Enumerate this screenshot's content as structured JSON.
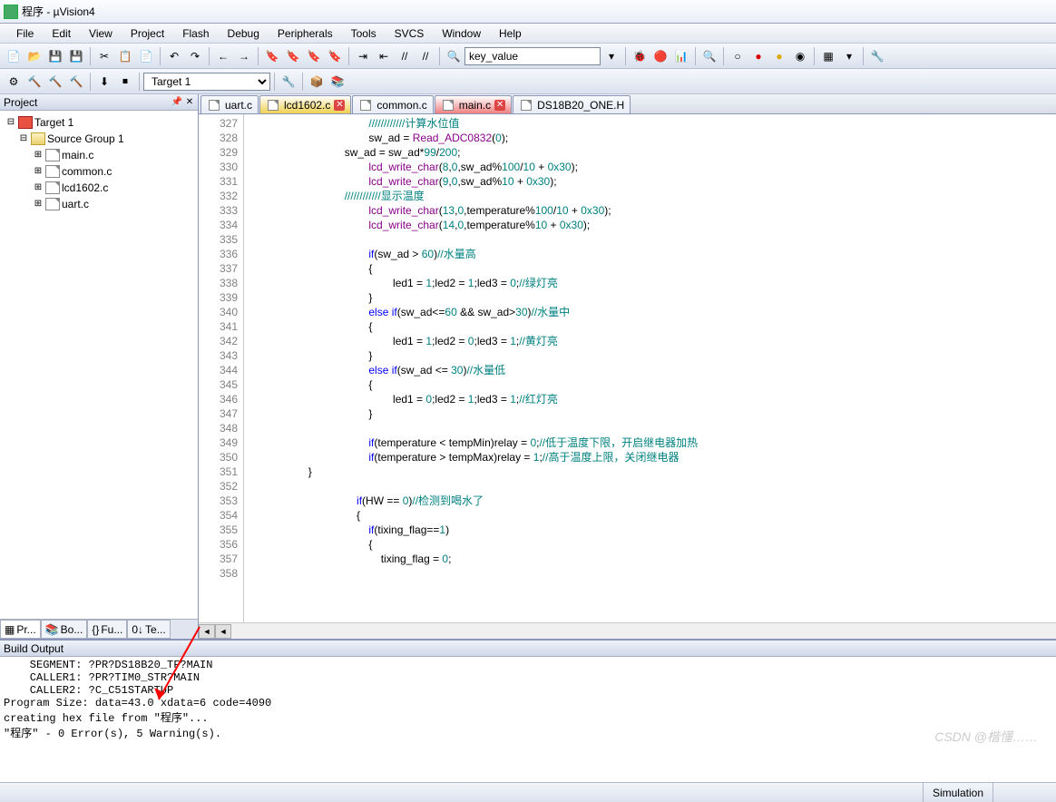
{
  "window_title": "程序 - µVision4",
  "menu": [
    "File",
    "Edit",
    "View",
    "Project",
    "Flash",
    "Debug",
    "Peripherals",
    "Tools",
    "SVCS",
    "Window",
    "Help"
  ],
  "toolbar2_combo": "key_value",
  "toolbar3_combo": "Target 1",
  "project_panel": {
    "title": "Project",
    "tree": {
      "root": "Target 1",
      "group": "Source Group 1",
      "files": [
        "main.c",
        "common.c",
        "lcd1602.c",
        "uart.c"
      ]
    },
    "tabs": [
      "Pr...",
      "Bo...",
      "Fu...",
      "Te..."
    ]
  },
  "file_tabs": [
    {
      "label": "uart.c",
      "active": false,
      "close": false
    },
    {
      "label": "lcd1602.c",
      "active": true,
      "close": true,
      "color": "#f0d050"
    },
    {
      "label": "common.c",
      "active": false,
      "close": false
    },
    {
      "label": "main.c",
      "active": false,
      "close": true,
      "color": "#f08080"
    },
    {
      "label": "DS18B20_ONE.H",
      "active": false,
      "close": false
    }
  ],
  "gutter_start": 327,
  "gutter_end": 358,
  "code_lines": [
    {
      "pad": 40,
      "seg": [
        {
          "t": "////////////计算水位值",
          "c": "com"
        }
      ]
    },
    {
      "pad": 40,
      "seg": [
        {
          "t": "sw_ad = "
        },
        {
          "t": "Read_ADC0832",
          "c": "fn"
        },
        {
          "t": "("
        },
        {
          "t": "0",
          "c": "num"
        },
        {
          "t": ");"
        }
      ]
    },
    {
      "pad": 32,
      "seg": [
        {
          "t": "sw_ad = sw_ad*"
        },
        {
          "t": "99",
          "c": "num"
        },
        {
          "t": "/"
        },
        {
          "t": "200",
          "c": "num"
        },
        {
          "t": ";"
        }
      ]
    },
    {
      "pad": 40,
      "seg": [
        {
          "t": "lcd_write_char",
          "c": "fn"
        },
        {
          "t": "("
        },
        {
          "t": "8",
          "c": "num"
        },
        {
          "t": ","
        },
        {
          "t": "0",
          "c": "num"
        },
        {
          "t": ",sw_ad%"
        },
        {
          "t": "100",
          "c": "num"
        },
        {
          "t": "/"
        },
        {
          "t": "10",
          "c": "num"
        },
        {
          "t": " + "
        },
        {
          "t": "0x30",
          "c": "num"
        },
        {
          "t": ");"
        }
      ]
    },
    {
      "pad": 40,
      "seg": [
        {
          "t": "lcd_write_char",
          "c": "fn"
        },
        {
          "t": "("
        },
        {
          "t": "9",
          "c": "num"
        },
        {
          "t": ","
        },
        {
          "t": "0",
          "c": "num"
        },
        {
          "t": ",sw_ad%"
        },
        {
          "t": "10",
          "c": "num"
        },
        {
          "t": " + "
        },
        {
          "t": "0x30",
          "c": "num"
        },
        {
          "t": ");"
        }
      ]
    },
    {
      "pad": 32,
      "seg": [
        {
          "t": "////////////显示温度",
          "c": "com"
        }
      ]
    },
    {
      "pad": 40,
      "seg": [
        {
          "t": "lcd_write_char",
          "c": "fn"
        },
        {
          "t": "("
        },
        {
          "t": "13",
          "c": "num"
        },
        {
          "t": ","
        },
        {
          "t": "0",
          "c": "num"
        },
        {
          "t": ",temperature%"
        },
        {
          "t": "100",
          "c": "num"
        },
        {
          "t": "/"
        },
        {
          "t": "10",
          "c": "num"
        },
        {
          "t": " + "
        },
        {
          "t": "0x30",
          "c": "num"
        },
        {
          "t": ");"
        }
      ]
    },
    {
      "pad": 40,
      "seg": [
        {
          "t": "lcd_write_char",
          "c": "fn"
        },
        {
          "t": "("
        },
        {
          "t": "14",
          "c": "num"
        },
        {
          "t": ","
        },
        {
          "t": "0",
          "c": "num"
        },
        {
          "t": ",temperature%"
        },
        {
          "t": "10",
          "c": "num"
        },
        {
          "t": " + "
        },
        {
          "t": "0x30",
          "c": "num"
        },
        {
          "t": ");"
        }
      ]
    },
    {
      "pad": 40,
      "seg": []
    },
    {
      "pad": 40,
      "seg": [
        {
          "t": "if",
          "c": "kw"
        },
        {
          "t": "(sw_ad > "
        },
        {
          "t": "60",
          "c": "num"
        },
        {
          "t": ")"
        },
        {
          "t": "//水量高",
          "c": "com"
        }
      ]
    },
    {
      "pad": 40,
      "seg": [
        {
          "t": "{"
        }
      ]
    },
    {
      "pad": 48,
      "seg": [
        {
          "t": "led1 = "
        },
        {
          "t": "1",
          "c": "num"
        },
        {
          "t": ";led2 = "
        },
        {
          "t": "1",
          "c": "num"
        },
        {
          "t": ";led3 = "
        },
        {
          "t": "0",
          "c": "num"
        },
        {
          "t": ";"
        },
        {
          "t": "//绿灯亮",
          "c": "com"
        }
      ]
    },
    {
      "pad": 40,
      "seg": [
        {
          "t": "}"
        }
      ]
    },
    {
      "pad": 40,
      "seg": [
        {
          "t": "else if",
          "c": "kw"
        },
        {
          "t": "(sw_ad<="
        },
        {
          "t": "60",
          "c": "num"
        },
        {
          "t": " && sw_ad>"
        },
        {
          "t": "30",
          "c": "num"
        },
        {
          "t": ")"
        },
        {
          "t": "//水量中",
          "c": "com"
        }
      ]
    },
    {
      "pad": 40,
      "seg": [
        {
          "t": "{"
        }
      ]
    },
    {
      "pad": 48,
      "seg": [
        {
          "t": "led1 = "
        },
        {
          "t": "1",
          "c": "num"
        },
        {
          "t": ";led2 = "
        },
        {
          "t": "0",
          "c": "num"
        },
        {
          "t": ";led3 = "
        },
        {
          "t": "1",
          "c": "num"
        },
        {
          "t": ";"
        },
        {
          "t": "//黄灯亮",
          "c": "com"
        }
      ]
    },
    {
      "pad": 40,
      "seg": [
        {
          "t": "}"
        }
      ]
    },
    {
      "pad": 40,
      "seg": [
        {
          "t": "else if",
          "c": "kw"
        },
        {
          "t": "(sw_ad <= "
        },
        {
          "t": "30",
          "c": "num"
        },
        {
          "t": ")"
        },
        {
          "t": "//水量低",
          "c": "com"
        }
      ]
    },
    {
      "pad": 40,
      "seg": [
        {
          "t": "{"
        }
      ]
    },
    {
      "pad": 48,
      "seg": [
        {
          "t": "led1 = "
        },
        {
          "t": "0",
          "c": "num"
        },
        {
          "t": ";led2 = "
        },
        {
          "t": "1",
          "c": "num"
        },
        {
          "t": ";led3 = "
        },
        {
          "t": "1",
          "c": "num"
        },
        {
          "t": ";"
        },
        {
          "t": "//红灯亮",
          "c": "com"
        }
      ]
    },
    {
      "pad": 40,
      "seg": [
        {
          "t": "}"
        }
      ]
    },
    {
      "pad": 40,
      "seg": []
    },
    {
      "pad": 40,
      "seg": [
        {
          "t": "if",
          "c": "kw"
        },
        {
          "t": "(temperature < tempMin)relay = "
        },
        {
          "t": "0",
          "c": "num"
        },
        {
          "t": ";"
        },
        {
          "t": "//低于温度下限，开启继电器加热",
          "c": "com"
        }
      ]
    },
    {
      "pad": 40,
      "seg": [
        {
          "t": "if",
          "c": "kw"
        },
        {
          "t": "(temperature > tempMax)relay = "
        },
        {
          "t": "1",
          "c": "num"
        },
        {
          "t": ";"
        },
        {
          "t": "//高于温度上限，关闭继电器",
          "c": "com"
        }
      ]
    },
    {
      "pad": 20,
      "seg": [
        {
          "t": "}"
        }
      ]
    },
    {
      "pad": 20,
      "seg": []
    },
    {
      "pad": 36,
      "seg": [
        {
          "t": "if",
          "c": "kw"
        },
        {
          "t": "(HW == "
        },
        {
          "t": "0",
          "c": "num"
        },
        {
          "t": ")"
        },
        {
          "t": "//检测到喝水了",
          "c": "com"
        }
      ]
    },
    {
      "pad": 36,
      "seg": [
        {
          "t": "{"
        }
      ]
    },
    {
      "pad": 40,
      "seg": [
        {
          "t": "if",
          "c": "kw"
        },
        {
          "t": "(tixing_flag=="
        },
        {
          "t": "1",
          "c": "num"
        },
        {
          "t": ")"
        }
      ]
    },
    {
      "pad": 40,
      "seg": [
        {
          "t": "{"
        }
      ]
    },
    {
      "pad": 44,
      "seg": [
        {
          "t": "tixing_flag = "
        },
        {
          "t": "0",
          "c": "num"
        },
        {
          "t": ";"
        }
      ]
    },
    {
      "pad": 44,
      "seg": []
    }
  ],
  "build_output": {
    "title": "Build Output",
    "lines": [
      "    SEGMENT: ?PR?DS18B20_TF?MAIN",
      "    CALLER1: ?PR?TIM0_STR?MAIN",
      "    CALLER2: ?C_C51STARTUP",
      "Program Size: data=43.0 xdata=6 code=4090",
      "creating hex file from \"程序\"...",
      "\"程序\" - 0 Error(s), 5 Warning(s)."
    ]
  },
  "status": "Simulation",
  "watermark": "CSDN @楷懂……"
}
